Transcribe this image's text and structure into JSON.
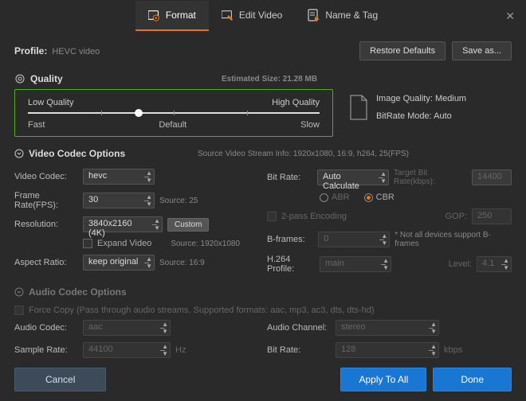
{
  "tabs": {
    "format": "Format",
    "edit": "Edit Video",
    "name": "Name & Tag"
  },
  "profile": {
    "label": "Profile:",
    "value": "HEVC video"
  },
  "buttons": {
    "restore": "Restore Defaults",
    "saveas": "Save as...",
    "custom": "Custom",
    "cancel": "Cancel",
    "applyAll": "Apply To All",
    "done": "Done"
  },
  "quality": {
    "title": "Quality",
    "est": "Estimated Size: 21.28 MB",
    "low": "Low Quality",
    "high": "High Quality",
    "fast": "Fast",
    "default": "Default",
    "slow": "Slow",
    "imgQuality": "Image Quality: Medium",
    "bitrateMode": "BitRate Mode: Auto"
  },
  "video": {
    "title": "Video Codec Options",
    "srcInfo": "Source Video Stream Info: 1920x1080, 16:9, h264, 25(FPS)",
    "codecLabel": "Video Codec:",
    "codec": "hevc",
    "fpsLabel": "Frame Rate(FPS):",
    "fps": "30",
    "fpsSrc": "Source: 25",
    "resLabel": "Resolution:",
    "res": "3840x2160 (4K)",
    "resSrc": "Source: 1920x1080",
    "expand": "Expand Video",
    "aspectLabel": "Aspect Ratio:",
    "aspect": "keep original",
    "aspectSrc": "Source: 16:9",
    "bitrateLabel": "Bit Rate:",
    "bitrate": "Auto Calculate",
    "targetLabel": "Target Bit Rate(kbps):",
    "target": "14400",
    "abr": "ABR",
    "cbr": "CBR",
    "twopass": "2-pass Encoding",
    "gopLabel": "GOP:",
    "gop": "250",
    "bframesLabel": "B-frames:",
    "bframes": "0",
    "bframesNote": "* Not all devices support B-frames",
    "profileLabel": "H.264 Profile:",
    "profile": "main",
    "levelLabel": "Level:",
    "level": "4.1"
  },
  "audio": {
    "title": "Audio Codec Options",
    "force": "Force Copy (Pass through audio streams. Supported formats: aac, mp3, ac3, dts, dts-hd)",
    "codecLabel": "Audio Codec:",
    "codec": "aac",
    "channelLabel": "Audio Channel:",
    "channel": "stereo",
    "rateLabel": "Sample Rate:",
    "rate": "44100",
    "hz": "Hz",
    "bitrateLabel": "Bit Rate:",
    "bitrate": "128",
    "kbps": "kbps"
  }
}
